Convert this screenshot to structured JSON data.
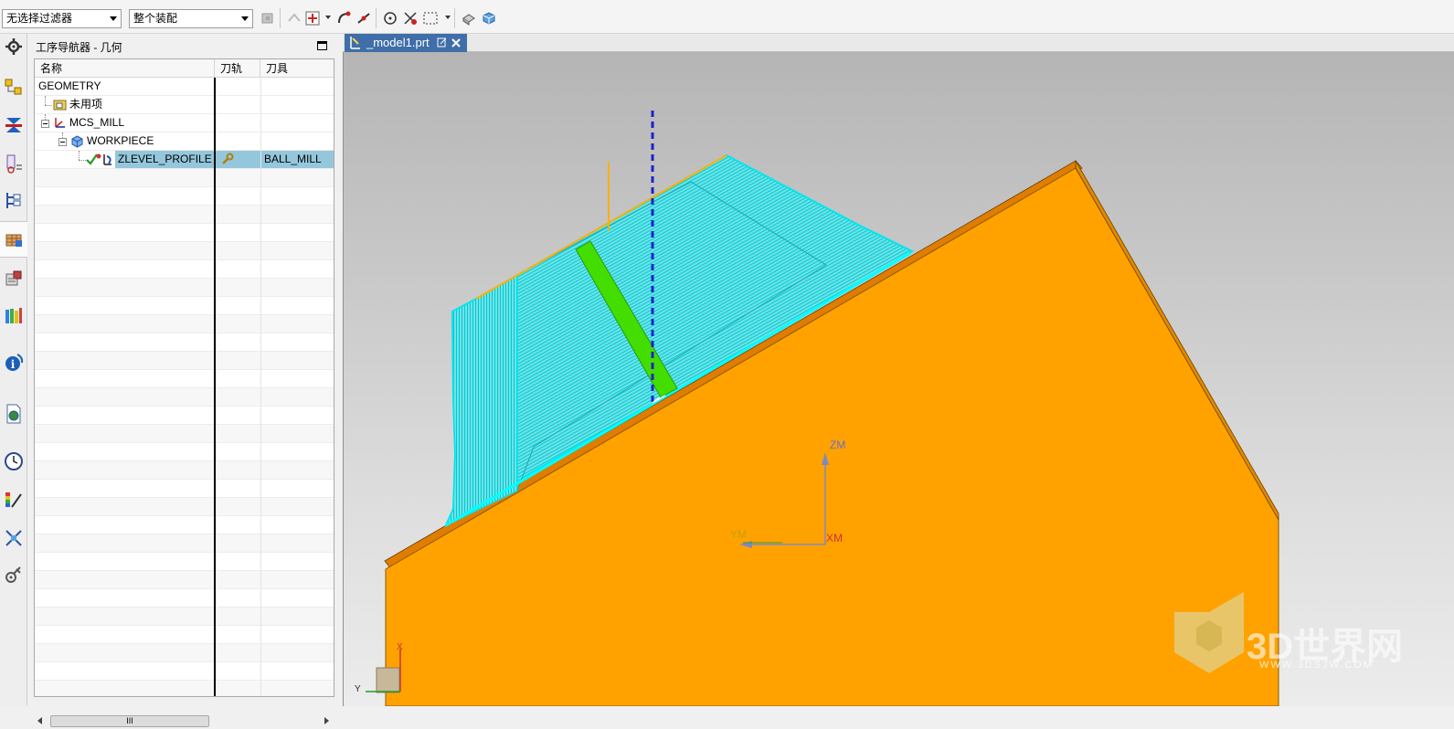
{
  "toolbar": {
    "filter_value": "无选择过滤器",
    "scope_value": "整个装配"
  },
  "navigator": {
    "title": "工序导航器 - 几何",
    "columns": [
      "名称",
      "刀轨",
      "刀具"
    ],
    "rows": [
      {
        "name": "GEOMETRY",
        "toolpath": "",
        "tool": ""
      },
      {
        "name": "未用项",
        "toolpath": "",
        "tool": ""
      },
      {
        "name": "MCS_MILL",
        "toolpath": "",
        "tool": ""
      },
      {
        "name": "WORKPIECE",
        "toolpath": "",
        "tool": ""
      },
      {
        "name": "ZLEVEL_PROFILE",
        "toolpath": "",
        "tool": "BALL_MILL"
      }
    ],
    "scroll_thumb": "III"
  },
  "viewport": {
    "tab_label": "_model1.prt",
    "axis_zm": "ZM",
    "axis_ym": "YM",
    "axis_xm": "XM",
    "triad_x": "X",
    "triad_y": "Y",
    "watermark": "3D世界网",
    "watermark_url": "WWW.3DSJW.COM"
  },
  "colors": {
    "part": "#ffa200",
    "toolpath": "#00f0f0",
    "tool": "#44dd00",
    "tab_active": "#3f6ea8"
  },
  "icons": [
    "gear-icon",
    "part-navigator-icon",
    "assembly-constraints-icon",
    "machine-tool-icon",
    "operation-navigator-icon",
    "reuse-library-icon",
    "roles-icon",
    "history-icon",
    "info-icon",
    "web-browser-icon",
    "clock-icon",
    "palette-icon",
    "system-scene-icon",
    "process-icon"
  ]
}
